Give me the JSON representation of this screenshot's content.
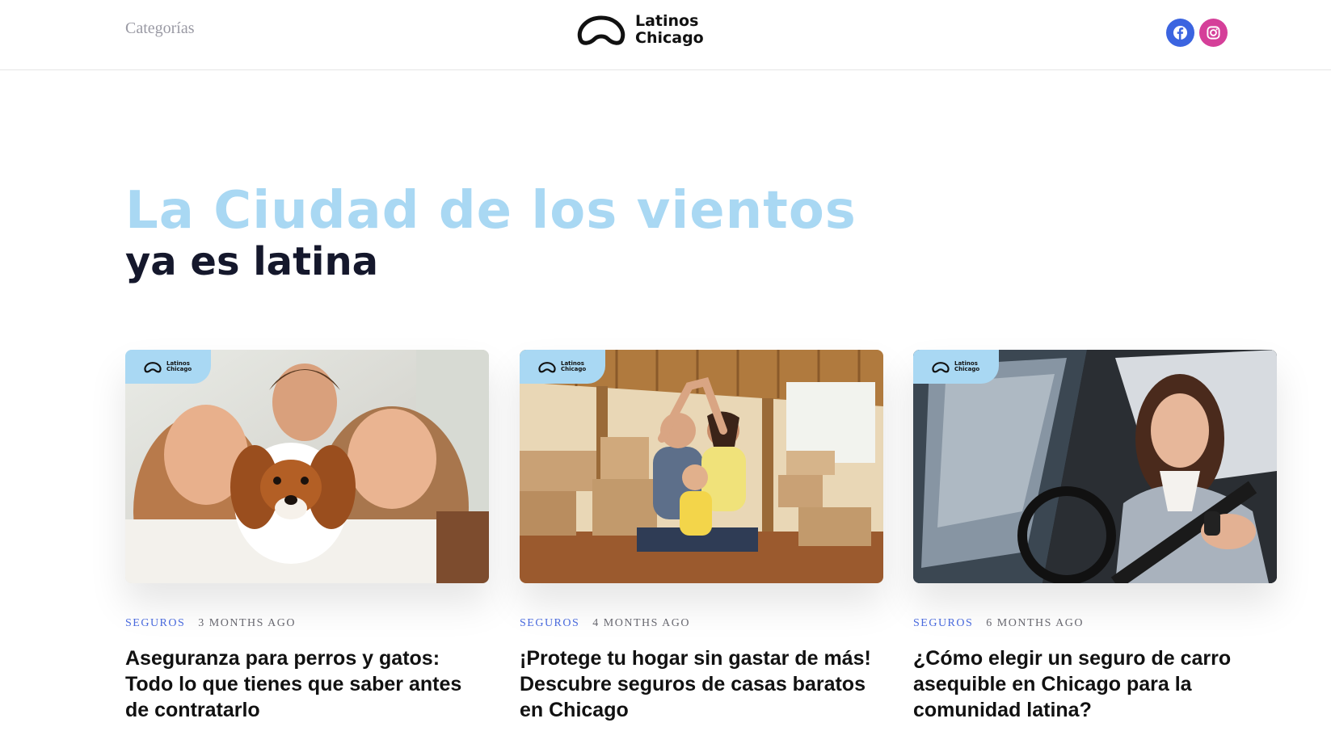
{
  "header": {
    "nav_label": "Categorías",
    "logo_line1": "Latinos",
    "logo_line2": "Chicago",
    "social": [
      "facebook-icon",
      "instagram-icon"
    ]
  },
  "hero": {
    "line1": "La Ciudad de los vientos",
    "line2": "ya es latina"
  },
  "cards": [
    {
      "badge_line1": "Latinos",
      "badge_line2": "Chicago",
      "category": "SEGUROS",
      "time": "3 MONTHS AGO",
      "title": "Aseguranza para perros y gatos: Todo lo que tienes que saber antes de contratarlo",
      "image": "kids-with-puppy-photo"
    },
    {
      "badge_line1": "Latinos",
      "badge_line2": "Chicago",
      "category": "SEGUROS",
      "time": "4 MONTHS AGO",
      "title": "¡Protege tu hogar sin gastar de más! Descubre seguros de casas baratos en Chicago",
      "image": "family-with-boxes-photo"
    },
    {
      "badge_line1": "Latinos",
      "badge_line2": "Chicago",
      "category": "SEGUROS",
      "time": "6 MONTHS AGO",
      "title": "¿Cómo elegir un seguro de carro asequible en Chicago para la comunidad latina?",
      "image": "woman-driving-car-photo"
    }
  ],
  "colors": {
    "hero_light_blue": "#a9d8f3",
    "hero_dark": "#15182c",
    "category_blue": "#4a6be0",
    "facebook_blue": "#3b64e0",
    "instagram_pink": "#d53f99"
  }
}
